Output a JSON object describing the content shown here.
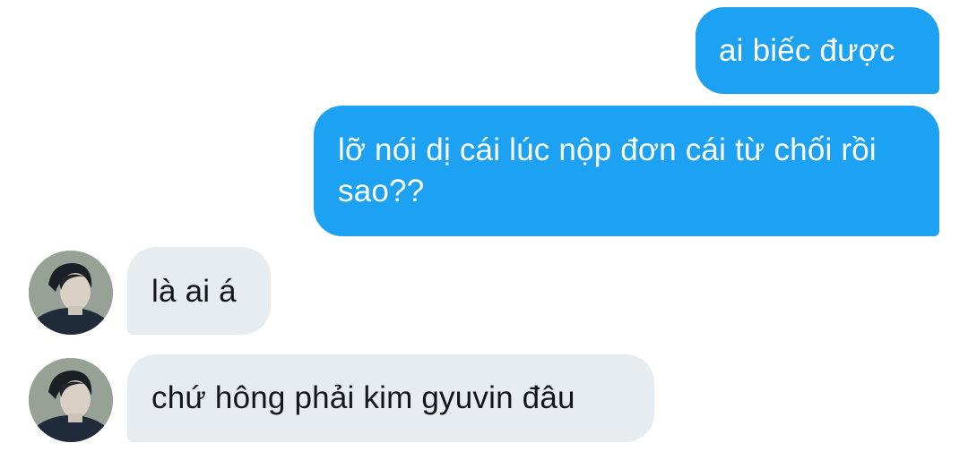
{
  "messages": [
    {
      "direction": "sent",
      "text": "ai biếc được"
    },
    {
      "direction": "sent",
      "text": "lỡ nói dị cái lúc nộp đơn cái từ chối rồi sao??"
    },
    {
      "direction": "received",
      "text": "là ai á"
    },
    {
      "direction": "received",
      "text": "chứ hông phải kim gyuvin đâu"
    }
  ],
  "colors": {
    "sent_bubble": "#1da1f2",
    "received_bubble": "#e6ecf0",
    "sent_text": "#ffffff",
    "received_text": "#14171a"
  }
}
